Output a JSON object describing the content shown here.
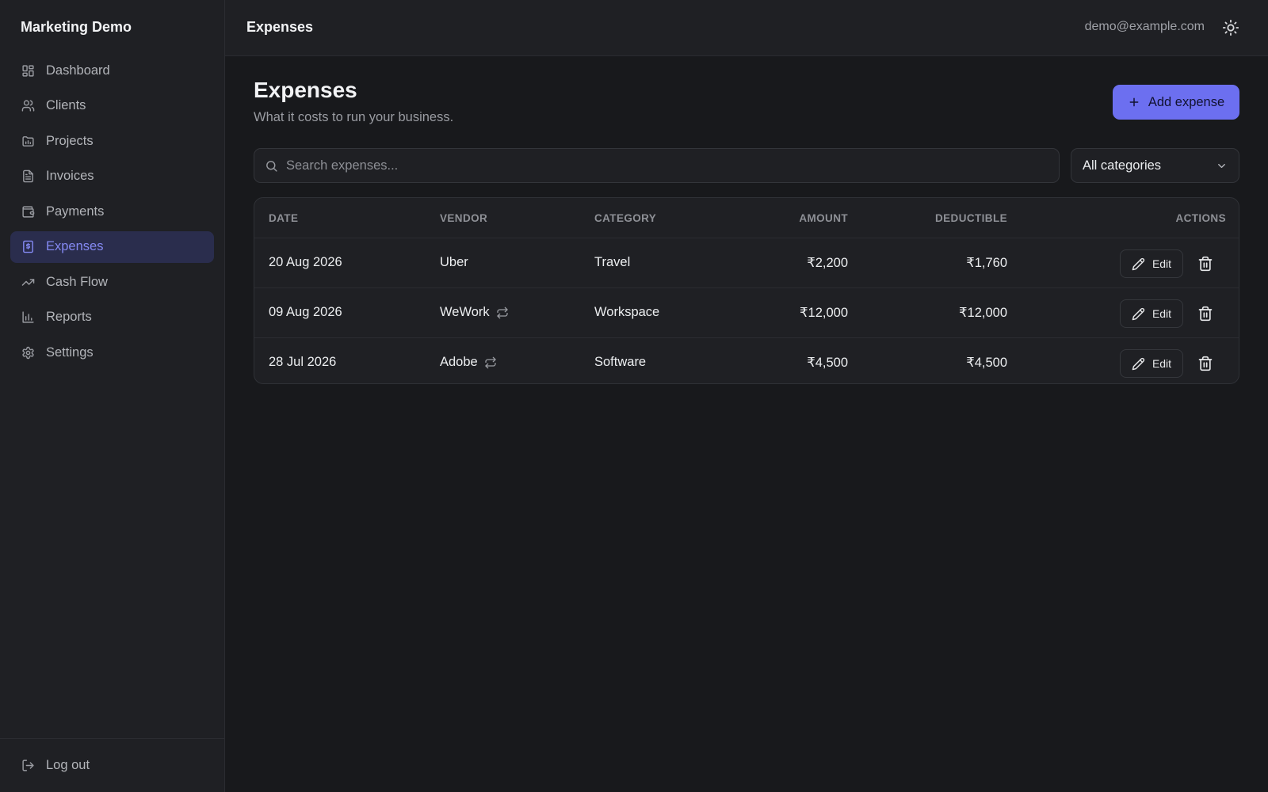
{
  "app": {
    "title": "Marketing Demo"
  },
  "sidebar": {
    "items": [
      {
        "label": "Dashboard",
        "icon": "dashboard-icon"
      },
      {
        "label": "Clients",
        "icon": "users-icon"
      },
      {
        "label": "Projects",
        "icon": "folder-icon"
      },
      {
        "label": "Invoices",
        "icon": "file-text-icon"
      },
      {
        "label": "Payments",
        "icon": "wallet-icon"
      },
      {
        "label": "Expenses",
        "icon": "receipt-icon",
        "active": true
      },
      {
        "label": "Cash Flow",
        "icon": "trending-up-icon"
      },
      {
        "label": "Reports",
        "icon": "bar-chart-icon"
      },
      {
        "label": "Settings",
        "icon": "gear-icon"
      }
    ],
    "logout_label": "Log out"
  },
  "topbar": {
    "title": "Expenses",
    "user_email": "demo@example.com",
    "theme_icon": "sun-icon"
  },
  "page": {
    "title": "Expenses",
    "subtitle": "What it costs to run your business.",
    "add_button_label": "Add expense"
  },
  "filters": {
    "search_placeholder": "Search expenses...",
    "category_selected": "All categories"
  },
  "table": {
    "headers": {
      "date": "DATE",
      "vendor": "VENDOR",
      "category": "CATEGORY",
      "amount": "AMOUNT",
      "deductible": "DEDUCTIBLE",
      "actions": "ACTIONS"
    },
    "edit_label": "Edit",
    "rows": [
      {
        "date": "20 Aug 2026",
        "vendor": "Uber",
        "recurring": false,
        "category": "Travel",
        "amount": "₹2,200",
        "deductible": "₹1,760"
      },
      {
        "date": "09 Aug 2026",
        "vendor": "WeWork",
        "recurring": true,
        "category": "Workspace",
        "amount": "₹12,000",
        "deductible": "₹12,000"
      },
      {
        "date": "28 Jul 2026",
        "vendor": "Adobe",
        "recurring": true,
        "category": "Software",
        "amount": "₹4,500",
        "deductible": "₹4,500"
      }
    ]
  },
  "colors": {
    "accent": "#6c6ff0",
    "active_nav_bg": "#2a2d4d",
    "background": "#18191c",
    "panel": "#1f2024"
  }
}
